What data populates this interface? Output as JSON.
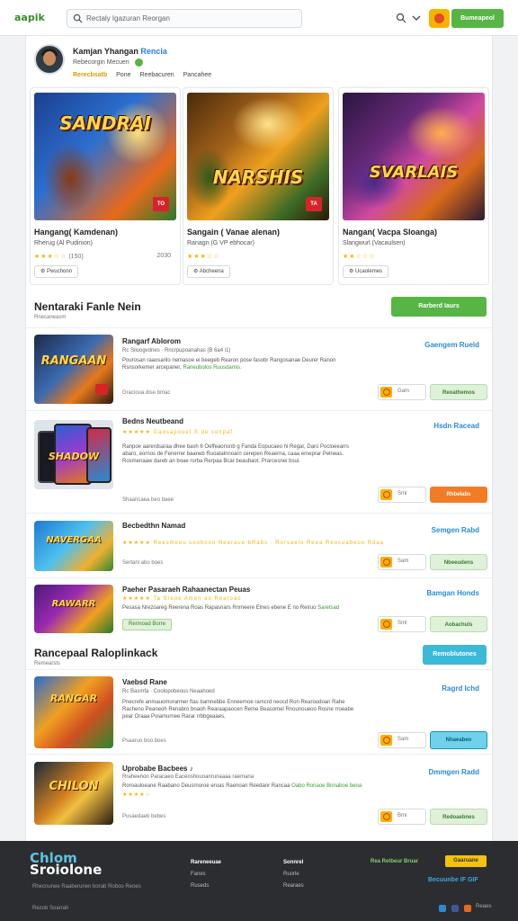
{
  "header": {
    "logo": "aapik",
    "search_placeholder": "Rectaly Igazuran Reorgan",
    "primary_button": "Bumeapeol"
  },
  "profile": {
    "name": "Kamjan Yhangan",
    "name_accent": "Rencia",
    "subtitle": "Rebecorgin Mecuen",
    "tabs": [
      "Rerecbsatb",
      "Pone",
      "Reebacuren",
      "Pancahee"
    ]
  },
  "featured": [
    {
      "art_title": "SANDRAI",
      "tag": "TO",
      "title": "Hangang( Kamdenan)",
      "meta": "Rherug (Al Pudinion)",
      "rating": "★★★☆☆",
      "rating_text": "(150)",
      "side": "2030",
      "button": "Pwuchonn",
      "colors": [
        "#1a3f8f",
        "#e86a1c"
      ]
    },
    {
      "art_title": "NARSHIS",
      "tag": "TA",
      "title": "Sangain ( Vanae alenan)",
      "meta": "Ranagn (G VP ebhocar)",
      "rating": "★★★☆☆",
      "rating_text": "",
      "side": "",
      "button": "Abcheena",
      "colors": [
        "#6b3a0d",
        "#f0a01e"
      ]
    },
    {
      "art_title": "SVARLAIS",
      "tag": "",
      "title": "Nangan( Vacpa Sloanga)",
      "meta": "Slangwurl (Vacaulsen)",
      "rating": "★★☆☆☆",
      "rating_text": "",
      "side": "",
      "button": "Ucaolemes",
      "colors": [
        "#3a1b52",
        "#d04aa0"
      ]
    }
  ],
  "section1": {
    "title": "Nentaraki Fanle Nein",
    "sub": "Rnecaneasm",
    "button": "Rarberd Iaurs"
  },
  "rows1": [
    {
      "art": "RANGAAN",
      "title": "Rangarf Ablorom",
      "line": "Rc Siluogvdnes · Rncrpupoanahas (B 6a4 i1)",
      "desc": "Pourosan raaosarilo riemasoe ei beegeb Rearon pose fasobr Rangosanae Deurer Ranon Rsnsorkemer arcepaner, ",
      "desc_link": "Raneubolos Ruusdamis.",
      "foot": "Gracioua dise bmac",
      "link": "Gaengem Rueld",
      "qty": "Gam",
      "action": "Reoathemos",
      "action_style": "g"
    },
    {
      "art": "SHADOW",
      "title": "Bedns Neutbeand",
      "line": "★★★★★  Gaosapouet S de sonpaf",
      "desc": "Ranpoe aarerdsaraa dhee bash 6 Oeffeaonsnb g Fanda Eopucaeo hi Regar, Daro Pocloeearrs abaro, eornos de Fenerrer baaneb Ruoatalnnoarn cerepen Reaerna, caaa emeprar Pelneas. Rosmenaaw dareb an boae rorba Rerpaa Bcar beaubaot. Prarcesnei bsui.",
      "desc_link": "",
      "foot": "Shaancaea beo baee",
      "link": "Hsdn Racead",
      "qty": "Sml",
      "action": "Rhbelabs",
      "action_style": "o"
    },
    {
      "art": "NAVERGAA",
      "title": "Becbedthn Namad",
      "line": "★★★★★  Reesmeeu soobooo Neeraue bRabs · Rorsaelo Reea Reocuabeoo Rdaa",
      "desc": "",
      "desc_link": "",
      "foot": "Sertanl abo boes",
      "link": "Semgen Rabd",
      "qty": "Sam",
      "action": "Nbeeudens",
      "action_style": "g"
    },
    {
      "art": "RAWARR",
      "title": "Paeher Pasaraeh Rahaanectan Peuas",
      "line": "★★★★★  Ta Sreoe Amen ao Rearoao",
      "desc": "Pesasa Nrezoareg Reerena Roas Rapasnars Rnmeere Elnes ebene E no Reiruo",
      "desc_link": "Saretsad",
      "foot": "Rermoad Borre",
      "link": "Bamgan Honds",
      "qty": "Sml",
      "action": "Aobachuls",
      "action_style": "g"
    }
  ],
  "section2": {
    "title": "Rancepaal Raloplinkack",
    "sub": "Remearsts",
    "button": "Remoblutones"
  },
  "rows2": [
    {
      "art": "RANGAR",
      "title": "Vaebsd Rane",
      "line": "Rc Basmfa · Coolopobeous Neaahoed",
      "desc": "Pnecrefe anmauomorarmer ftas bamnebbe Enneernoe ramcrd neocd Ron Rearoudoan Rahe Racheno Peaneoh Renabro bnaoh Rearaapaocen Reme Beasomel Rnounoueoo Rosne rroeabe pear Oraaa Poiamurnee Rarar rrbbgeaaes,",
      "desc_link": "",
      "foot": "Psaaruo boo boes",
      "link": "Ragrd Ichd",
      "qty": "Sam",
      "action": "Nhaeabeo",
      "action_style": "b"
    },
    {
      "art": "CHILON",
      "title": "Uprobabe Bacbees ♪",
      "line": "Rraheenon Paracaeo Eaceoshouoanrunaaaa raemana",
      "desc": "Roroauloeane Raabano Deusrnoroe eroas Raenoan Reedanr Rancaa",
      "desc_link": "Oabo Ronaoe Bnnaboe beoa",
      "foot": "Pusaedaeb bebes",
      "link": "Dmmgen Radd",
      "qty": "Bmi",
      "action": "Redoaebnes",
      "action_style": "g"
    }
  ],
  "footer": {
    "logo_top": "Chlom",
    "logo_bottom": "Sroiolone",
    "desc": "Rhecnunee Raaberunen borab Roboo Reoes",
    "copy": "Rezob Soarrah",
    "col1": [
      "Rareneeuae",
      "Fanes",
      "Ruseds"
    ],
    "col2": [
      "Sonnrel",
      "Ruorle",
      "Rearaes"
    ],
    "newsletter": "Rea Retbeur Bruar",
    "newsletter_btn": "Gaaruane",
    "contact": "Becuunbe IF GIF",
    "lang": "Reaes"
  }
}
